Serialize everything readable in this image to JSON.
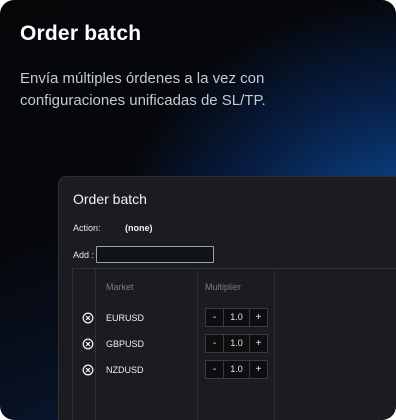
{
  "hero": {
    "title": "Order batch",
    "subtitle": "Envía múltiples órdenes a la vez con configuraciones unificadas de SL/TP."
  },
  "window": {
    "title": "Order batch",
    "action_label": "Action:",
    "action_value": "(none)",
    "add_label": "Add :",
    "add_value": ""
  },
  "table": {
    "columns": [
      "Market",
      "Multiplier"
    ],
    "rows": [
      {
        "market": "EURUSD",
        "minus": "-",
        "multiplier": "1.0",
        "plus": "+"
      },
      {
        "market": "GBPUSD",
        "minus": "-",
        "multiplier": "1.0",
        "plus": "+"
      },
      {
        "market": "NZDUSD",
        "minus": "-",
        "multiplier": "1.0",
        "plus": "+"
      }
    ]
  },
  "icons": {
    "remove": "circle-x-icon"
  },
  "colors": {
    "accent_blue": "#0a4f9c",
    "window_bg": "#1b1c1f",
    "card_bg": "#050608"
  }
}
